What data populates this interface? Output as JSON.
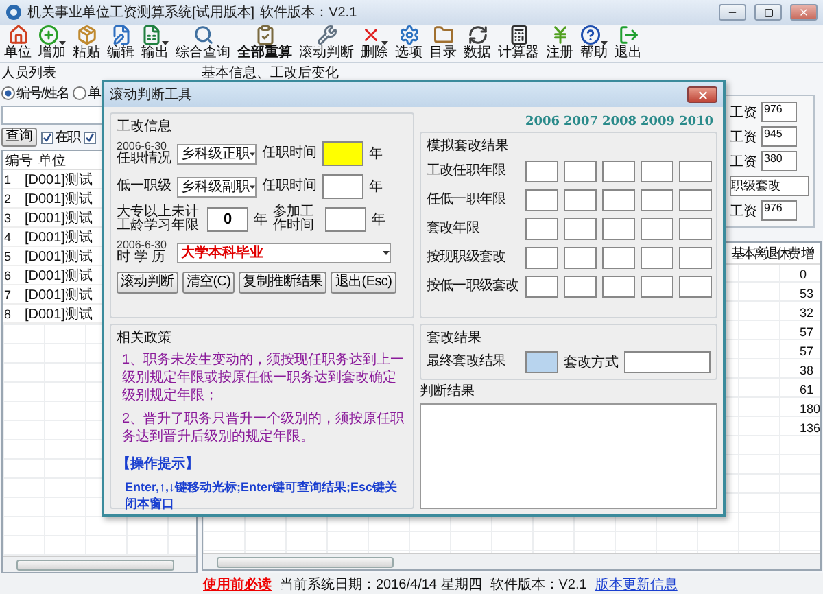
{
  "window": {
    "title": "机关事业单位工资测算系统[试用版本]",
    "version": "软件版本：V2.1"
  },
  "toolbar": [
    {
      "label": "单位",
      "kind": "house",
      "has_menu": false,
      "emphasized": false
    },
    {
      "label": "增加",
      "kind": "plus",
      "has_menu": true,
      "emphasized": false
    },
    {
      "label": "粘贴",
      "kind": "box",
      "has_menu": false,
      "emphasized": false
    },
    {
      "label": "编辑",
      "kind": "pencil",
      "has_menu": false,
      "emphasized": false
    },
    {
      "label": "输出",
      "kind": "sheet",
      "has_menu": true,
      "emphasized": false
    },
    {
      "label": "综合查询",
      "kind": "search",
      "has_menu": false,
      "emphasized": false
    },
    {
      "label": "全部重算",
      "kind": "clipboard",
      "has_menu": false,
      "emphasized": true
    },
    {
      "label": "滚动判断",
      "kind": "wrench",
      "has_menu": false,
      "emphasized": false
    },
    {
      "label": "删除",
      "kind": "cross",
      "has_menu": true,
      "emphasized": false
    },
    {
      "label": "选项",
      "kind": "gear",
      "has_menu": false,
      "emphasized": false
    },
    {
      "label": "目录",
      "kind": "folder",
      "has_menu": false,
      "emphasized": false
    },
    {
      "label": "数据",
      "kind": "refresh",
      "has_menu": false,
      "emphasized": false
    },
    {
      "label": "计算器",
      "kind": "calculator",
      "has_menu": false,
      "emphasized": false
    },
    {
      "label": "注册",
      "kind": "yen",
      "has_menu": false,
      "emphasized": false
    },
    {
      "label": "帮助",
      "kind": "help",
      "has_menu": true,
      "emphasized": false
    },
    {
      "label": "退出",
      "kind": "exit",
      "has_menu": false,
      "emphasized": false
    }
  ],
  "people_list": {
    "title": "人员列表",
    "search_modes": [
      {
        "label": "编号/姓名",
        "selected": true
      },
      {
        "label": "单",
        "selected": false
      }
    ],
    "query_button": "查询",
    "filters": [
      {
        "label": "在职",
        "checked": true
      },
      {
        "checked": true
      }
    ],
    "columns": [
      "编号",
      "单位"
    ],
    "rows": [
      [
        "1",
        "[D001]测试"
      ],
      [
        "2",
        "[D001]测试"
      ],
      [
        "3",
        "[D001]测试"
      ],
      [
        "4",
        "[D001]测试"
      ],
      [
        "5",
        "[D001]测试"
      ],
      [
        "6",
        "[D001]测试"
      ],
      [
        "7",
        "[D001]测试"
      ],
      [
        "8",
        "[D001]测试"
      ]
    ]
  },
  "detail": {
    "title": "基本信息、工改后变化",
    "fields": [
      {
        "kind": "salary",
        "label": "工资",
        "value": "976"
      },
      {
        "kind": "salary",
        "label": "工资",
        "value": "945"
      },
      {
        "kind": "salary",
        "label": "工资",
        "value": "380"
      },
      {
        "kind": "note",
        "value": "职级套改"
      },
      {
        "kind": "salary",
        "label": "工资",
        "value": "976"
      }
    ],
    "columns": [
      "基本离退休费",
      "增"
    ],
    "increases": [
      "0",
      "53",
      "32",
      "57",
      "57",
      "38",
      "61",
      "180",
      "136"
    ]
  },
  "dialog": {
    "title": "滚动判断工具",
    "reform_info": {
      "title": "工改信息",
      "rows": [
        {
          "kind": "select",
          "caption": "2006-6-30",
          "label": "任职情况",
          "value": "乡科级正职",
          "side_label": "任职时间",
          "side_focused": true,
          "unit": "年"
        },
        {
          "kind": "select",
          "label": "低一职级",
          "value": "乡科级副职",
          "side_label": "任职时间",
          "side_focused": false,
          "unit": "年"
        },
        {
          "kind": "years",
          "label": "大专以上未计工龄学习年限",
          "value": "0",
          "unit": "年",
          "side_label": "参加工作时间",
          "side_focused": false,
          "side_unit": "年"
        }
      ],
      "education": {
        "caption": "2006-6-30",
        "label": "时 学 历",
        "value": "大学本科毕业"
      },
      "buttons": [
        "滚动判断",
        "清空(C)",
        "复制推断结果",
        "退出(Esc)"
      ]
    },
    "simulation": {
      "title": "模拟套改结果",
      "years": [
        "2006",
        "2007",
        "2008",
        "2009",
        "2010"
      ],
      "rows": [
        "工改任职年限",
        "任低一职年限",
        "套改年限",
        "按现职级套改",
        "按低一职级套改"
      ]
    },
    "result": {
      "title": "套改结果",
      "final_label": "最终套改结果",
      "method_label": "套改方式",
      "judgement_title": "判断结果"
    },
    "policy": {
      "title": "相关政策",
      "items": [
        "1、职务未发生变动的，须按现任职务达到上一级别规定年限或按原任低一职务达到套改确定级别规定年限；",
        "2、晋升了职务只晋升一个级别的，须按原任职务达到晋升后级别的规定年限。"
      ],
      "tips_title": "【操作提示】",
      "tips": "Enter,↑,↓键移动光标;Enter键可查询结果;Esc键关闭本窗口"
    }
  },
  "status_bar": {
    "notice": "使用前必读",
    "date": "当前系统日期：2016/4/14 星期四",
    "version": "软件版本：V2.1",
    "link": "版本更新信息"
  }
}
